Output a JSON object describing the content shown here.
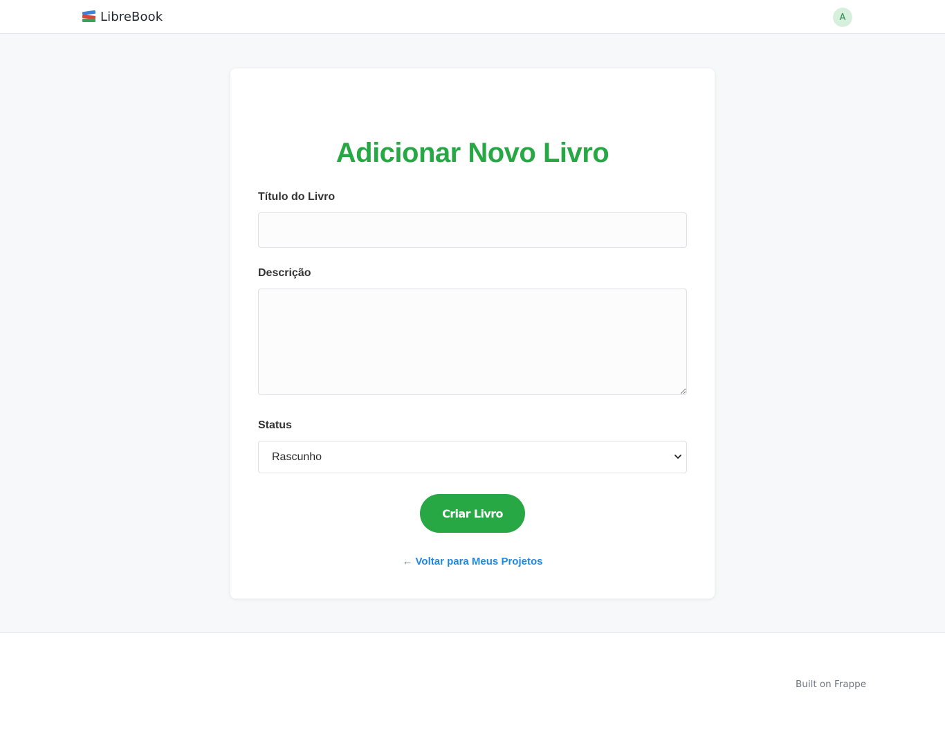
{
  "header": {
    "brand_name": "LibreBook",
    "brand_icon": "books-icon",
    "avatar_initial": "A"
  },
  "form": {
    "title": "Adicionar Novo Livro",
    "fields": {
      "book_title": {
        "label": "Título do Livro",
        "value": "",
        "placeholder": ""
      },
      "description": {
        "label": "Descrição",
        "value": "",
        "placeholder": ""
      },
      "status": {
        "label": "Status",
        "selected": "Rascunho"
      }
    },
    "submit_label": "Criar Livro",
    "back_link": {
      "arrow": "←",
      "label": "Voltar para Meus Projetos"
    }
  },
  "footer": {
    "text": "Built on Frappe"
  },
  "colors": {
    "accent": "#28a745",
    "link": "#1e88e5",
    "background": "#f7f8f9",
    "avatar_bg": "#d7f0de"
  }
}
